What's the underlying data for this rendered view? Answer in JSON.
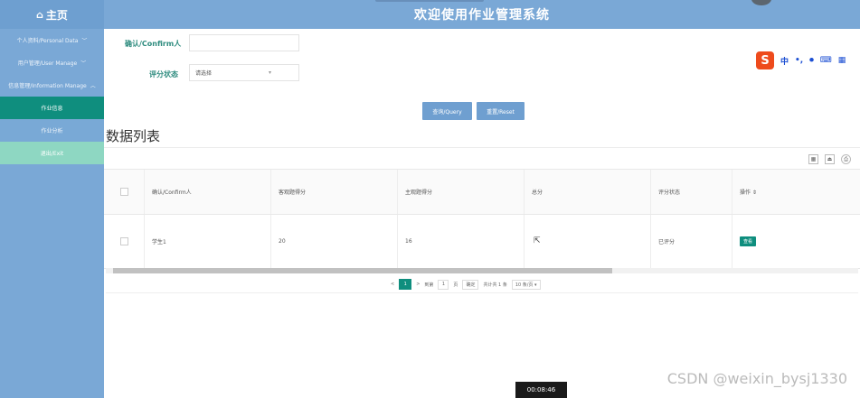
{
  "header": {
    "title": "欢迎使用作业管理系统"
  },
  "sidebar": {
    "brand": "主页",
    "items": [
      {
        "label": "个人资料/Personal Data",
        "chevron": "﹀"
      },
      {
        "label": "用户管理/User Manage",
        "chevron": "﹀"
      },
      {
        "label": "信息管理/Information Manage",
        "chevron": "︿"
      },
      {
        "label": "作业信息"
      },
      {
        "label": "作业分析"
      },
      {
        "label": "退出/Exit"
      }
    ]
  },
  "form": {
    "confirm_label": "确认/Confirm人",
    "status_label": "评分状态",
    "status_value": "请选择",
    "query_btn": "查询/Query",
    "reset_btn": "重置/Reset"
  },
  "ime": {
    "chinese": "中",
    "punct": "•,",
    "mic": "🎤",
    "keyboard": "⌨",
    "grid": "▦"
  },
  "section_title": "数据列表",
  "table": {
    "headers": [
      "确认/Confirm人",
      "客观题得分",
      "主观题得分",
      "总分",
      "评分状态",
      "操作 ⇕"
    ],
    "rows": [
      {
        "confirm": "学生1",
        "objective": "20",
        "subjective": "16",
        "total": "",
        "status": "已评分",
        "action": "查看"
      }
    ]
  },
  "pager": {
    "prev": "<",
    "current": "1",
    "next": ">",
    "goto": "到第",
    "page_input": "1",
    "page_unit": "页",
    "confirm": "确定",
    "total": "共计共 1 条",
    "size": "10 条/页 ▾"
  },
  "timer": "00:08:46",
  "watermark": "CSDN @weixin_bysj1330"
}
